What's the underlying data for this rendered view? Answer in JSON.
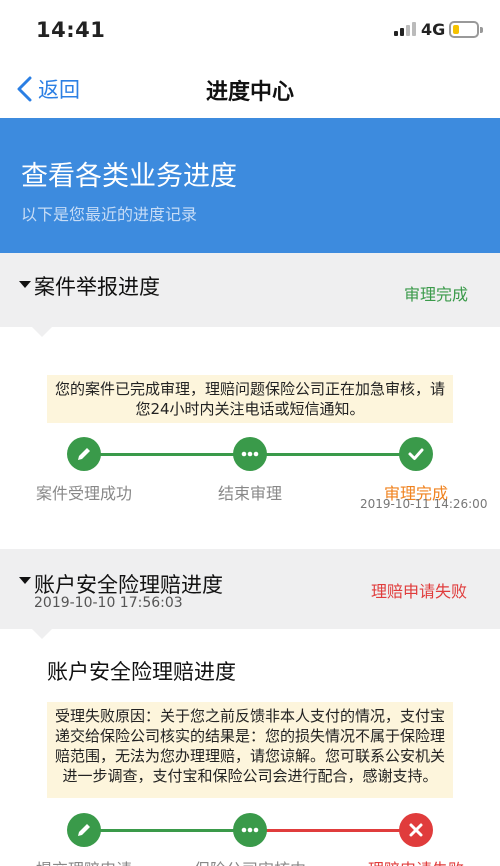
{
  "status_bar": {
    "time": "14:41",
    "network": "4G"
  },
  "nav": {
    "back_label": "返回",
    "title": "进度中心"
  },
  "banner": {
    "title": "查看各类业务进度",
    "subtitle": "以下是您最近的进度记录"
  },
  "case_report": {
    "title": "案件举报进度",
    "status": "审理完成",
    "status_color": "#3a9a4a",
    "notice": "您的案件已完成审理，理赔问题保险公司正在加急审核，请您24小时内关注电话或短信通知。",
    "steps": [
      {
        "label": "案件受理成功",
        "icon": "pencil-icon"
      },
      {
        "label": "结束审理",
        "icon": "dots-icon"
      },
      {
        "label": "审理完成",
        "icon": "check-icon",
        "time": "2019-10-11 14:26:00"
      }
    ]
  },
  "account_claim": {
    "title": "账户安全险理赔进度",
    "date": "2019-10-10 17:56:03",
    "status": "理赔申请失败",
    "status_color": "#e03c3c",
    "card_title": "账户安全险理赔进度",
    "notice": "受理失败原因：关于您之前反馈非本人支付的情况，支付宝递交给保险公司核实的结果是：您的损失情况不属于保险理赔范围，无法为您办理理赔，请您谅解。您可联系公安机关进一步调查，支付宝和保险公司会进行配合，感谢支持。",
    "steps": [
      {
        "label": "提交理赔申请",
        "icon": "pencil-icon"
      },
      {
        "label": "保险公司审核中",
        "icon": "dots-icon"
      },
      {
        "label": "理赔申请失败",
        "icon": "close-icon"
      }
    ]
  },
  "colors": {
    "green": "#3a9a4a",
    "red": "#e03c3c",
    "orange": "#f0821e",
    "blue": "#3d8bde"
  }
}
